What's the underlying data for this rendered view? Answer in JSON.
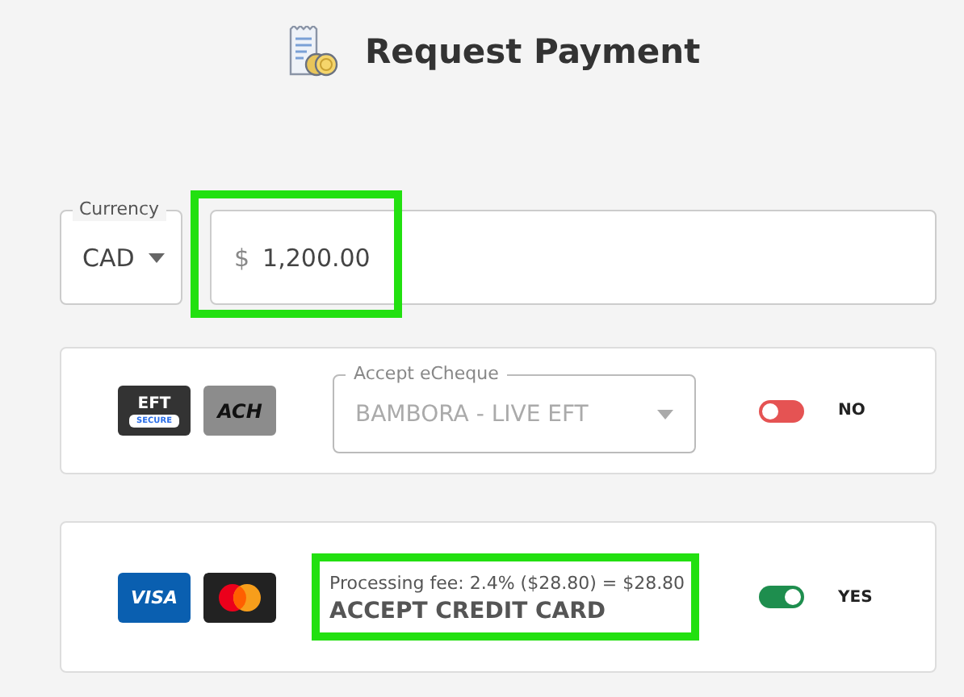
{
  "header": {
    "title": "Request Payment"
  },
  "amount": {
    "currency_label": "Currency",
    "currency": "CAD",
    "symbol": "$",
    "value": "1,200.00",
    "highlighted": true
  },
  "methods": [
    {
      "kind": "dropdown",
      "badges": [
        {
          "kind": "eft",
          "text": "EFT",
          "subtext": "SECURE"
        },
        {
          "kind": "ach",
          "text": "ACH"
        }
      ],
      "label": "Accept eCheque",
      "value": "BAMBORA - LIVE EFT",
      "disabled": true,
      "on": false,
      "state_label": "NO"
    },
    {
      "kind": "fee",
      "badges": [
        {
          "kind": "visa",
          "text": "VISA"
        },
        {
          "kind": "mastercard"
        }
      ],
      "fee": "Processing fee: 2.4% ($28.80) = $28.80",
      "label": "ACCEPT CREDIT CARD",
      "on": true,
      "state_label": "YES",
      "highlighted": true
    }
  ]
}
